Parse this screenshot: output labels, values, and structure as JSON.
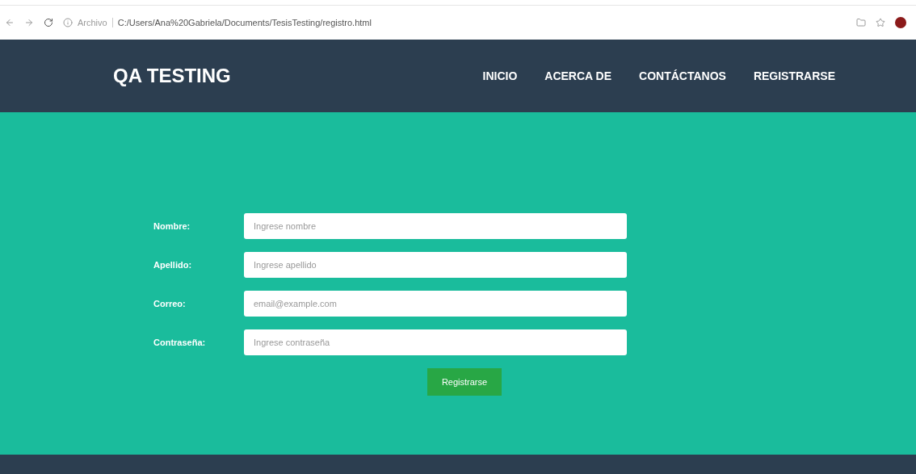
{
  "browser": {
    "security_label": "Archivo",
    "url": "C:/Users/Ana%20Gabriela/Documents/TesisTesting/registro.html"
  },
  "nav": {
    "brand": "QA TESTING",
    "links": [
      "INICIO",
      "ACERCA DE",
      "CONTÁCTANOS",
      "REGISTRARSE"
    ]
  },
  "form": {
    "fields": [
      {
        "label": "Nombre:",
        "placeholder": "Ingrese nombre"
      },
      {
        "label": "Apellido:",
        "placeholder": "Ingrese apellido"
      },
      {
        "label": "Correo:",
        "placeholder": "email@example.com"
      },
      {
        "label": "Contraseña:",
        "placeholder": "Ingrese contraseña"
      }
    ],
    "submit": "Registrarse"
  }
}
